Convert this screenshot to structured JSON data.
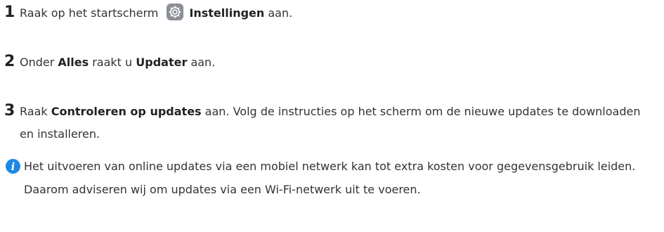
{
  "steps": [
    {
      "number": "1",
      "before": "Raak op het startscherm",
      "icon": "settings-gear-icon",
      "bold": "Instellingen",
      "after": " aan."
    },
    {
      "number": "2",
      "before": "Onder ",
      "bold1": "Alles",
      "middle": " raakt u ",
      "bold2": "Updater",
      "after": " aan."
    },
    {
      "number": "3",
      "before": "Raak ",
      "bold": "Controleren op updates",
      "after": " aan. Volg de instructies op het scherm om de nieuwe updates te downloaden en installeren."
    }
  ],
  "note": {
    "icon": "info-icon",
    "text": "Het uitvoeren van online updates via een mobiel netwerk kan tot extra kosten voor gegevensgebruik leiden. Daarom adviseren wij om updates via een Wi-Fi-netwerk uit te voeren."
  },
  "colors": {
    "info_icon": "#1e88e5",
    "gear_icon_bg": "#8a8f96",
    "text": "#333333"
  }
}
